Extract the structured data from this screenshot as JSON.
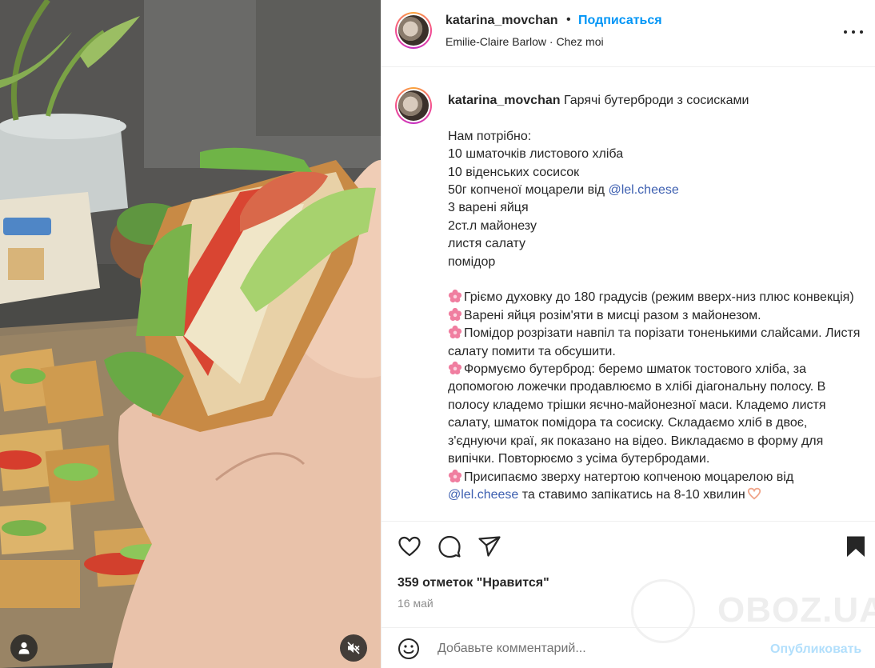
{
  "post": {
    "username": "katarina_movchan",
    "separator": "•",
    "follow_label": "Подписаться",
    "audio": "Emilie-Claire Barlow",
    "audio_separator": "·",
    "location": "Chez moi"
  },
  "caption": {
    "username": "katarina_movchan",
    "title": "Гарячі бутерброди з сосисками",
    "lines": [
      "Нам потрібно:",
      "10 шматочків листового хліба",
      "10 віденських сосисок",
      "50г копченої моцарели від ",
      "3 варені яйця",
      "2ст.л майонезу",
      "листя салату",
      "помідор"
    ],
    "mention": "@lel.cheese",
    "steps": [
      "Гріємо духовку до 180 градусів (режим вверх-низ плюс конвекція)",
      "Варені яйця розім'яти в мисці разом з майонезом.",
      "Помідор розрізати навпіл та порізати тоненькими слайсами. Листя салату помити та обсушити.",
      "Формуємо бутерброд: беремо шматок тостового хліба, за допомогою ложечки продавлюємо в хлібі діагональну полосу. В полосу кладемо трішки яєчно-майонезної маси. Кладемо листя салату, шматок помідора та сосиску. Складаємо хліб в двоє, з'єднуючи краї, як показано на відео. Викладаємо в форму для випічки. Повторюємо з усіма бутербродами.",
      "Присипаємо зверху натертою копченою моцарелою від"
    ],
    "last_mention": "@lel.cheese",
    "last_tail": " та ставимо запікатись на 8-10 хвилин"
  },
  "stats": {
    "likes": "359 отметок \"Нравится\"",
    "date": "16 май"
  },
  "watermark": "OBOZ.UA",
  "comment": {
    "placeholder": "Добавьте комментарий...",
    "post_label": "Опубликовать"
  },
  "icons": {
    "like": "heart-icon",
    "comment": "comment-icon",
    "share": "share-icon",
    "save": "bookmark-icon",
    "more": "more-icon",
    "emoji": "emoji-icon",
    "user_tag": "user-icon",
    "mute": "speaker-muted-icon",
    "bullet": "flower-icon"
  },
  "colors": {
    "follow": "#0095f6",
    "mention": "#3d5fb0",
    "post_disabled": "#b2dffc",
    "flower": "#f07ea0"
  }
}
